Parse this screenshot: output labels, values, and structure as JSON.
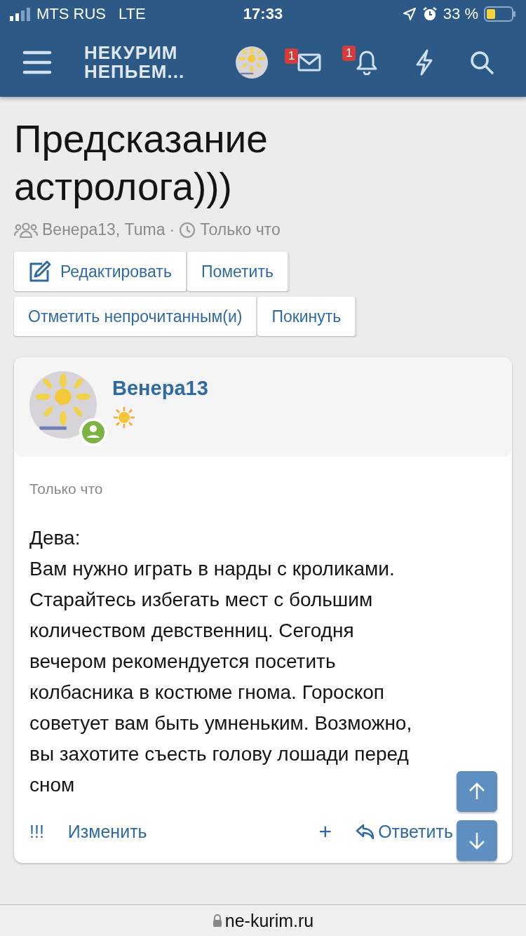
{
  "status_bar": {
    "carrier": "MTS RUS",
    "network": "LTE",
    "time": "17:33",
    "battery": "33 %"
  },
  "nav": {
    "logo_lines": [
      "НЕКУРИМ",
      "НЕПЬЕМ..."
    ],
    "messages_badge": "1",
    "alerts_badge": "1"
  },
  "thread": {
    "title": "Предсказание астролога)))",
    "participants": "Венера13, Tuma",
    "separator": "·",
    "time": "Только что"
  },
  "actions": [
    {
      "label": "Редактировать",
      "kind": "edit"
    },
    {
      "label": "Пометить",
      "kind": "plain"
    },
    {
      "label": "Отметить непрочитанным(и)",
      "kind": "plain"
    },
    {
      "label": "Покинуть",
      "kind": "plain"
    }
  ],
  "post": {
    "author": "Венера13",
    "online": true,
    "time": "Только что",
    "lines": [
      "Дева:",
      "Вам нужно играть в нарды с кроликами.",
      "Старайтесь избегать мест с большим",
      "количеством девственниц. Сегодня",
      "вечером рекомендуется посетить",
      "колбасника в костюме гнома. Гороскоп",
      "советует вам быть умненьким. Возможно,",
      "вы захотите съесть голову лошади перед",
      "сном"
    ],
    "footer": {
      "marks": "!!!",
      "edit": "Изменить",
      "plus": "+",
      "reply": "Ответить"
    }
  },
  "url_bar": {
    "address": "ne-kurim.ru"
  }
}
